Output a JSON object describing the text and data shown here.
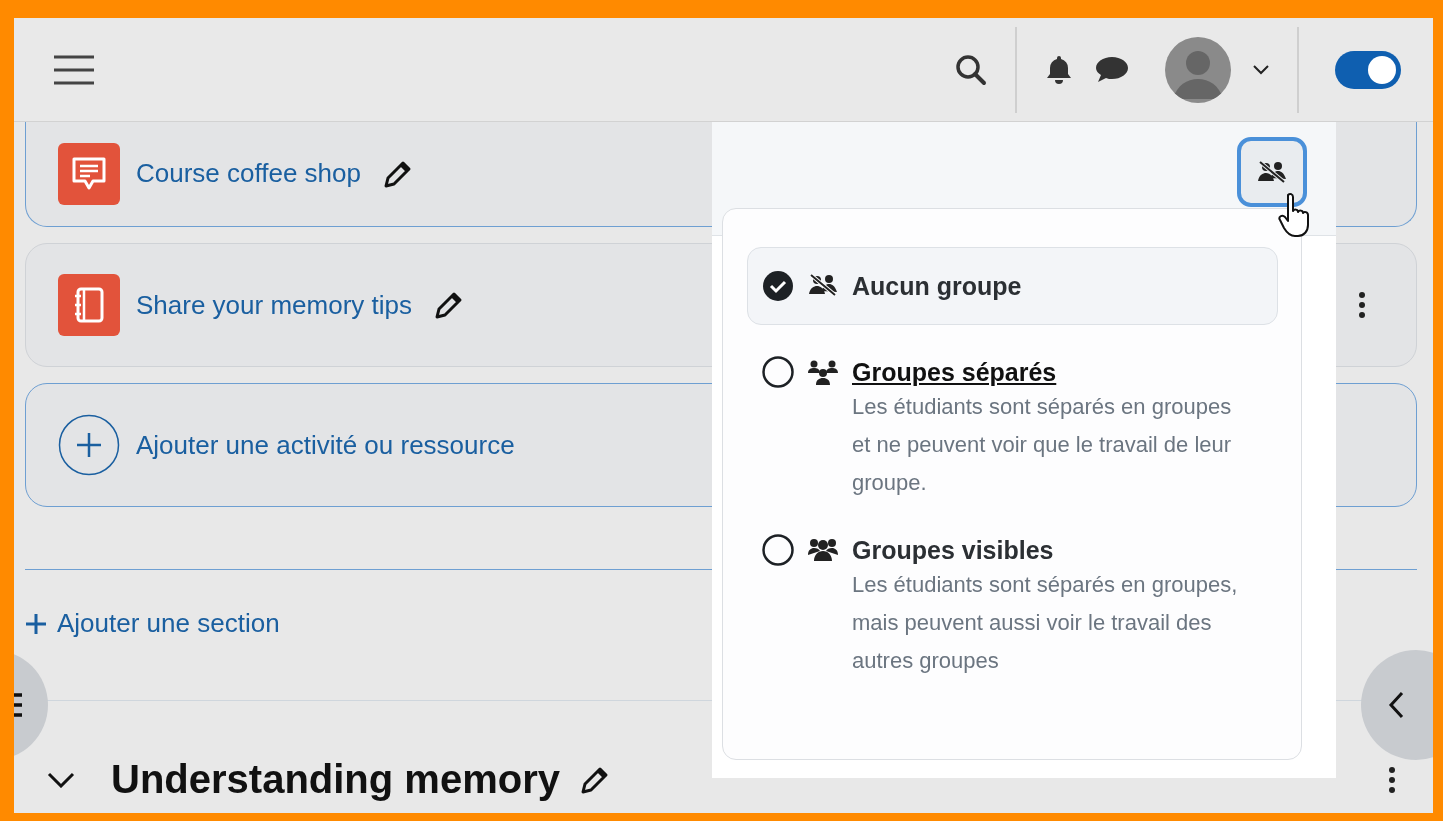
{
  "topbar": {
    "dark_mode_toggle": {
      "on": true
    }
  },
  "activities": [
    {
      "name": "Course coffee shop",
      "kind": "forum"
    },
    {
      "name": "Share your memory tips",
      "kind": "glossary"
    }
  ],
  "add_activity": "Ajouter une activité ou ressource",
  "add_section": "Ajouter une section",
  "section_title": "Understanding memory",
  "group_menu": {
    "options": [
      {
        "kind": "none",
        "label": "Aucun groupe",
        "selected": true,
        "underlined": false
      },
      {
        "kind": "separate",
        "label": "Groupes séparés",
        "description": "Les étudiants sont séparés en groupes et ne peuvent voir que le travail de leur groupe.",
        "selected": false,
        "underlined": true
      },
      {
        "kind": "visible",
        "label": "Groupes visibles",
        "description": "Les étudiants sont séparés en groupes, mais peuvent aussi voir le travail des autres groupes",
        "selected": false,
        "underlined": false
      }
    ]
  }
}
